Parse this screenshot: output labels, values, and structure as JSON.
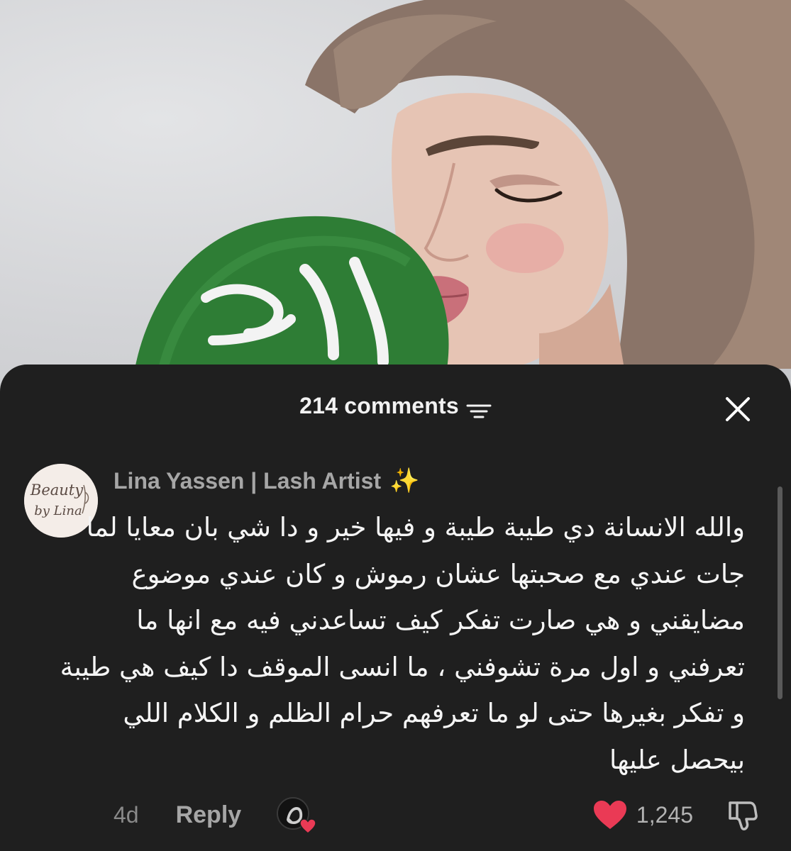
{
  "header": {
    "comments_count": "214 comments"
  },
  "icons": {
    "sort": "sort-lines-icon",
    "close": "close-icon",
    "like": "heart-icon",
    "dislike": "thumbs-down-icon",
    "creator_liked": "creator-heart-icon"
  },
  "colors": {
    "sheet_background": "#1f1f1f",
    "like_heart": "#ea3a55",
    "username": "#a6a6a6",
    "flag_green": "#2e7d35"
  },
  "comment": {
    "avatar_logo_lines": [
      "Beauty",
      "by Lina"
    ],
    "author": "Lina Yassen | Lash Artist",
    "author_emoji": "✨",
    "lines": [
      "والله الانسانة دي طيبة طيبة و فيها خير و دا شي بان معايا لما",
      "جات عندي مع صحبتها عشان رموش و كان عندي موضوع",
      "مضايقني و هي صارت تفكر كيف تساعدني فيه مع انها ما",
      "تعرفني و اول مرة تشوفني ، ما انسى الموقف دا كيف هي طيبة",
      "و تفكر بغيرها حتى لو ما تعرفهم حرام الظلم و الكلام اللي",
      "بيحصل عليها"
    ],
    "time": "4d",
    "reply_label": "Reply",
    "likes": "1,245"
  }
}
